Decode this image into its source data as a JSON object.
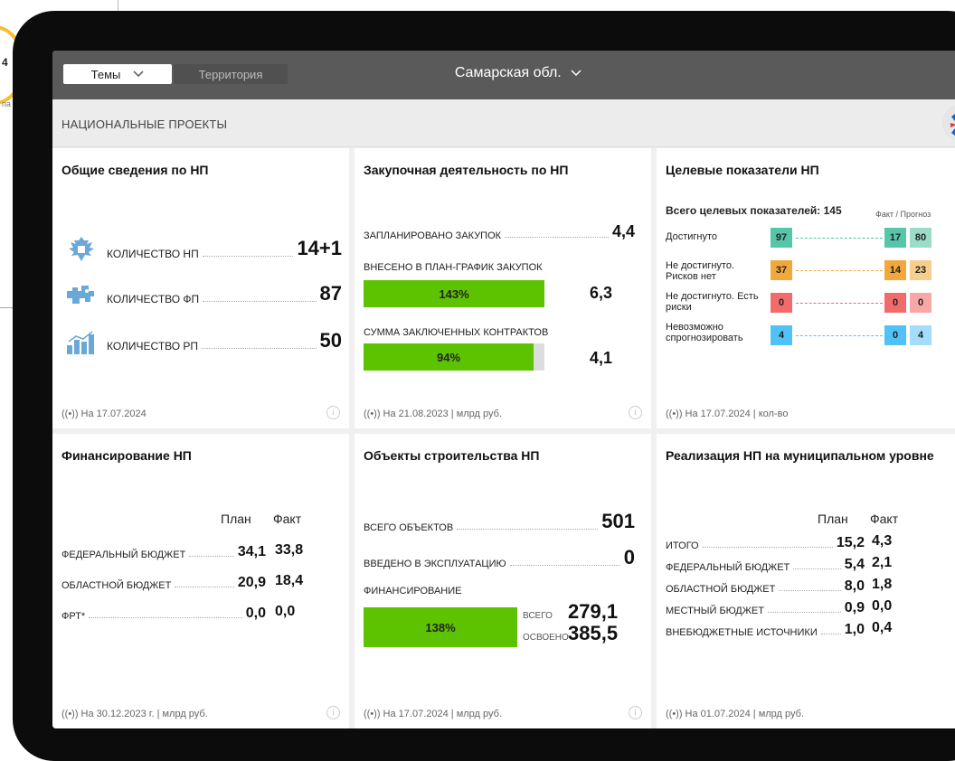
{
  "background": {
    "partial_value": "4",
    "partial_caption": "па"
  },
  "topbar": {
    "themes_label": "Темы",
    "territory_label": "Территория",
    "region_label": "Самарская обл."
  },
  "subtitle": "НАЦИОНАЛЬНЫЕ ПРОЕКТЫ",
  "colors": {
    "green": "#5dc300",
    "teal": "#56c6a9",
    "orange": "#f2a93b",
    "red": "#f26b6b",
    "blue": "#4fc3f7",
    "topbar": "#5a5a5a"
  },
  "general": {
    "title": "Общие сведения по НП",
    "rows": [
      {
        "icon": "eagle-emblem-icon",
        "label": "КОЛИЧЕСТВО НП",
        "value": "14+1"
      },
      {
        "icon": "puzzle-map-icon",
        "label": "КОЛИЧЕСТВО ФП",
        "value": "87"
      },
      {
        "icon": "bar-growth-icon",
        "label": "КОЛИЧЕСТВО РП",
        "value": "50"
      }
    ],
    "footer": "((•)) На 17.07.2024"
  },
  "procurement": {
    "title": "Закупочная деятельность по НП",
    "planned_label": "ЗАПЛАНИРОВАНО ЗАКУПОК",
    "planned_value": "4,4",
    "schedule_label": "ВНЕСЕНО В ПЛАН-ГРАФИК ЗАКУПОК",
    "schedule_pct": "143%",
    "schedule_fill": 1.0,
    "schedule_value": "6,3",
    "contracts_label": "СУММА ЗАКЛЮЧЕННЫХ КОНТРАКТОВ",
    "contracts_pct": "94%",
    "contracts_fill": 0.94,
    "contracts_value": "4,1",
    "footer": "((•)) На 21.08.2023 | млрд руб."
  },
  "targets": {
    "title": "Целевые показатели НП",
    "total_label": "Всего целевых показателей: 145",
    "fact_forecast": "Факт / Прогноз",
    "rows": [
      {
        "label": "Достигнуто",
        "count": "97",
        "color": "#56c6a9",
        "fact": "17",
        "forecast": "80"
      },
      {
        "label": "Не достигнуто. Рисков нет",
        "count": "37",
        "color": "#f2a93b",
        "fact": "14",
        "forecast": "23"
      },
      {
        "label": "Не достигнуто. Есть риски",
        "count": "0",
        "color": "#f26b6b",
        "fact": "0",
        "forecast": "0"
      },
      {
        "label": "Невозможно спрогнозировать",
        "count": "4",
        "color": "#4fc3f7",
        "fact": "0",
        "forecast": "4"
      }
    ],
    "footer": "((•)) На 17.07.2024 | кол-во"
  },
  "financing": {
    "title": "Финансирование НП",
    "plan_hdr": "План",
    "fact_hdr": "Факт",
    "rows": [
      {
        "label": "ФЕДЕРАЛЬНЫЙ БЮДЖЕТ",
        "plan": "34,1",
        "fact": "33,8"
      },
      {
        "label": "ОБЛАСТНОЙ БЮДЖЕТ",
        "plan": "20,9",
        "fact": "18,4"
      },
      {
        "label": "ФРТ*",
        "plan": "0,0",
        "fact": "0,0"
      }
    ],
    "footer": "((•)) На 30.12.2023 г. | млрд руб."
  },
  "construction": {
    "title": "Объекты строительства НП",
    "total_label": "ВСЕГО ОБЪЕКТОВ",
    "total_value": "501",
    "commissioned_label": "ВВЕДЕНО В ЭКСПЛУАТАЦИЮ",
    "commissioned_value": "0",
    "financing_label": "ФИНАНСИРОВАНИЕ",
    "financing_pct": "138%",
    "financing_fill": 1.0,
    "total_fin_label": "ВСЕГО",
    "total_fin_value": "279,1",
    "mastered_label": "ОСВОЕНО",
    "mastered_value": "385,5",
    "footer": "((•)) На 17.07.2024 | млрд руб."
  },
  "municipal": {
    "title": "Реализация НП на муниципальном уровне",
    "plan_hdr": "План",
    "fact_hdr": "Факт",
    "rows": [
      {
        "label": "ИТОГО",
        "plan": "15,2",
        "fact": "4,3"
      },
      {
        "label": "ФЕДЕРАЛЬНЫЙ БЮДЖЕТ",
        "plan": "5,4",
        "fact": "2,1"
      },
      {
        "label": "ОБЛАСТНОЙ БЮДЖЕТ",
        "plan": "8,0",
        "fact": "1,8"
      },
      {
        "label": "МЕСТНЫЙ БЮДЖЕТ",
        "plan": "0,9",
        "fact": "0,0"
      },
      {
        "label": "ВНЕБЮДЖЕТНЫЕ ИСТОЧНИКИ",
        "plan": "1,0",
        "fact": "0,4"
      }
    ],
    "footer": "((•)) На 01.07.2024 | млрд руб."
  }
}
